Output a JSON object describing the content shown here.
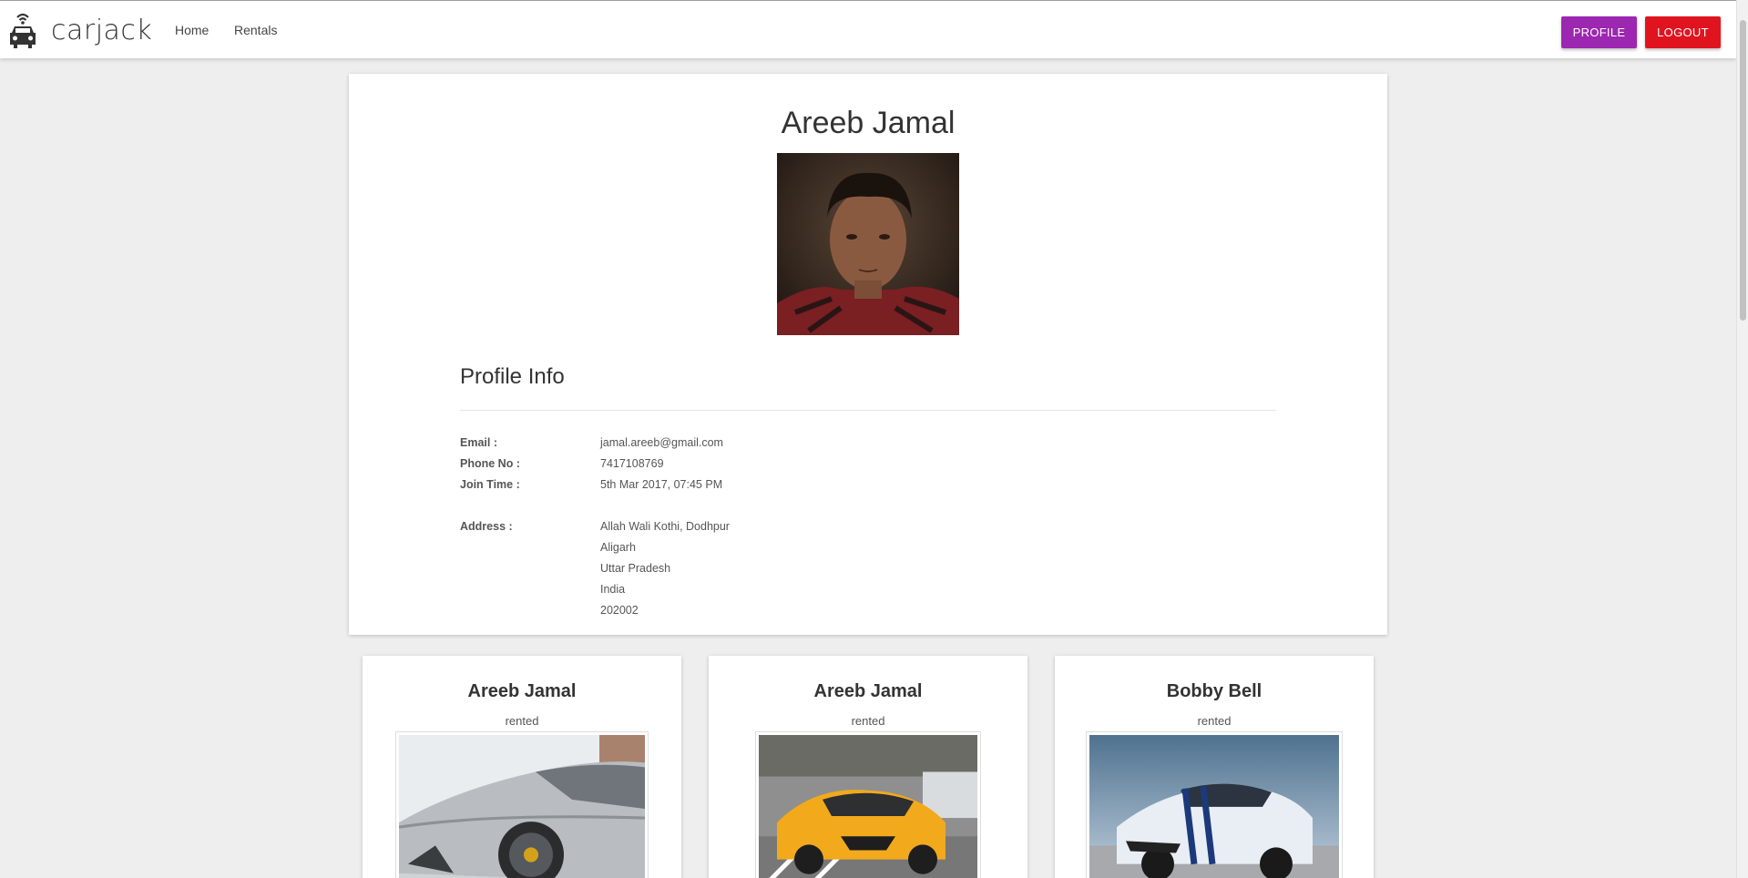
{
  "nav": {
    "brand": "carjack",
    "links": [
      "Home",
      "Rentals"
    ],
    "profile_button": "PROFILE",
    "logout_button": "LOGOUT"
  },
  "profile": {
    "name": "Areeb Jamal",
    "section_title": "Profile Info",
    "fields": [
      {
        "label": "Email :",
        "value": "jamal.areeb@gmail.com"
      },
      {
        "label": "Phone No :",
        "value": "7417108769"
      },
      {
        "label": "Join Time :",
        "value": "5th Mar 2017, 07:45 PM"
      }
    ],
    "address_label": "Address :",
    "address_lines": [
      "Allah Wali Kothi, Dodhpur",
      "Aligarh",
      "Uttar Pradesh",
      "India",
      "202002"
    ]
  },
  "rentals": [
    {
      "name": "Areeb Jamal",
      "status": "rented",
      "car_color": "#c8c8c8"
    },
    {
      "name": "Areeb Jamal",
      "status": "rented",
      "car_color": "#f2a91c"
    },
    {
      "name": "Bobby Bell",
      "status": "rented",
      "car_color": "#e8eef4"
    }
  ],
  "colors": {
    "profile_button": "#9c27b0",
    "logout_button": "#e0141f"
  }
}
